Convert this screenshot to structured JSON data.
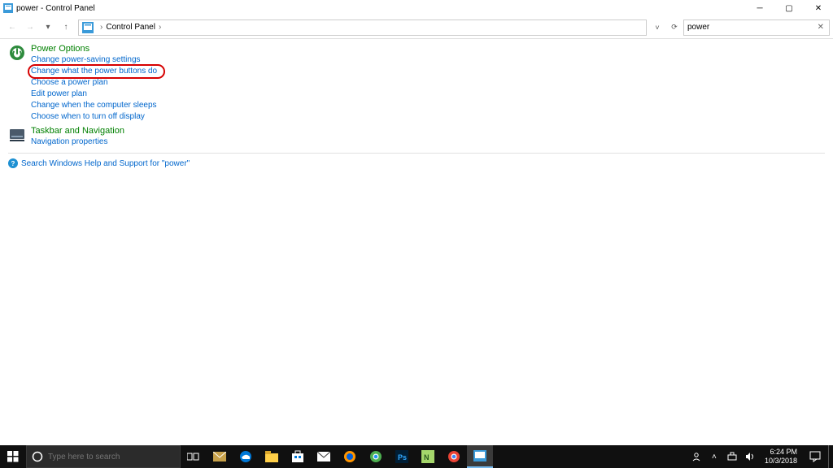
{
  "window": {
    "title": "power - Control Panel",
    "min_tooltip": "Minimize",
    "max_tooltip": "Maximize",
    "close_tooltip": "Close"
  },
  "nav": {
    "back": "Back",
    "forward": "Forward",
    "up": "Up",
    "breadcrumb_root": "Control Panel",
    "refresh": "Refresh",
    "dropdown": "Previous Locations"
  },
  "search": {
    "value": "power",
    "clear": "Clear"
  },
  "results": {
    "power_options": {
      "heading": "Power Options",
      "links": [
        "Change power-saving settings",
        "Change what the power buttons do",
        "Choose a power plan",
        "Edit power plan",
        "Change when the computer sleeps",
        "Choose when to turn off display"
      ],
      "highlight_index": 1
    },
    "taskbar_nav": {
      "heading": "Taskbar and Navigation",
      "links": [
        "Navigation properties"
      ]
    }
  },
  "help": {
    "text": "Search Windows Help and Support for \"power\""
  },
  "taskbar": {
    "search_placeholder": "Type here to search",
    "time": "6:24 PM",
    "date": "10/3/2018",
    "items": [
      "start",
      "cortana-search",
      "task-view",
      "mail",
      "edge",
      "file-explorer",
      "store",
      "mail-app",
      "firefox",
      "chrome",
      "photoshop",
      "notepadpp",
      "chrome-alt",
      "control-panel"
    ]
  },
  "colors": {
    "link": "#0066cc",
    "heading": "#008000",
    "highlight_ring": "#d60000"
  }
}
